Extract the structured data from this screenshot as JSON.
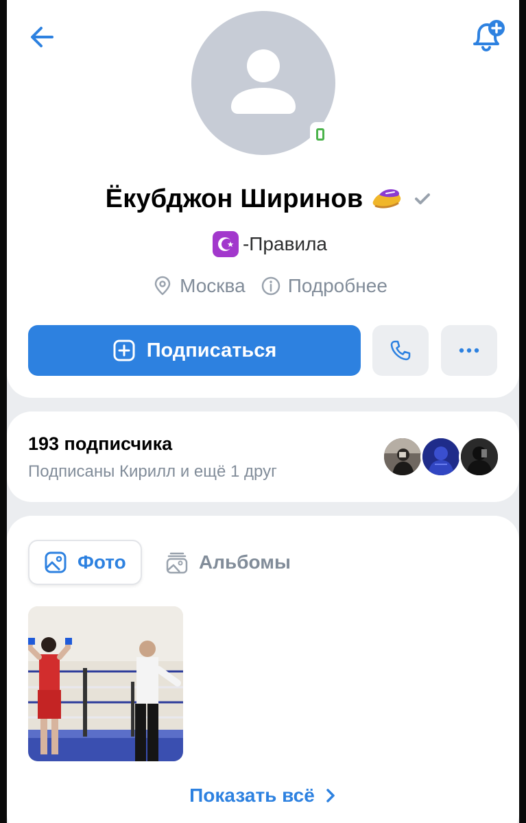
{
  "profile": {
    "name": "Ёкубджон Ширинов",
    "status_text": "-Правила",
    "city": "Москва",
    "details_label": "Подробнее"
  },
  "actions": {
    "subscribe_label": "Подписаться",
    "more_label": "•••"
  },
  "followers": {
    "count_text": "193 подписчика",
    "subtitle": "Подписаны Кирилл и ещё 1 друг"
  },
  "photos": {
    "tabs": [
      {
        "label": "Фото",
        "active": true
      },
      {
        "label": "Альбомы",
        "active": false
      }
    ],
    "show_all_label": "Показать всё"
  },
  "icons": {
    "back": "arrow-left-icon",
    "notifications": "bell-plus-icon",
    "verified": "check-icon",
    "location": "location-pin-icon",
    "info": "info-circle-icon",
    "call": "phone-icon",
    "more": "more-horizontal-icon",
    "photo": "image-icon",
    "albums": "album-stack-icon",
    "chevron": "chevron-right-icon"
  },
  "colors": {
    "accent": "#2d81e0",
    "secondary_text": "#818c99",
    "online": "#4bb34b",
    "background": "#ebedf0"
  }
}
